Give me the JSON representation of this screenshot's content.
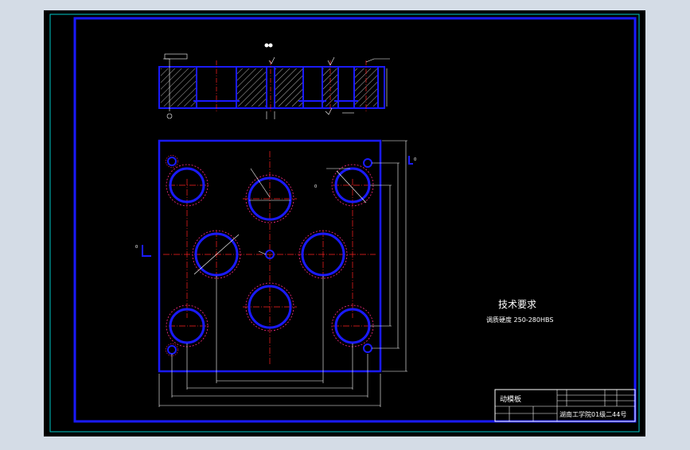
{
  "viewport": {
    "background": "#d4dce6",
    "sheet_color": "#000000",
    "frame_outer_color": "#00c8c8",
    "frame_inner_color": "#1a1aff",
    "center_line_color": "#ff2020",
    "hidden_circle_color": "#ff2a80",
    "hole_color": "#1a1aff"
  },
  "drawing": {
    "tech_title": "技术要求",
    "tech_note": "调质硬度 250-280HBS",
    "title_block": {
      "part_name": "动模板",
      "footer": "湖南工学院01级二44号"
    }
  },
  "icons": {
    "roughness_symbol": "roughness-check-icon",
    "datum_symbol": "datum-l-icon"
  }
}
